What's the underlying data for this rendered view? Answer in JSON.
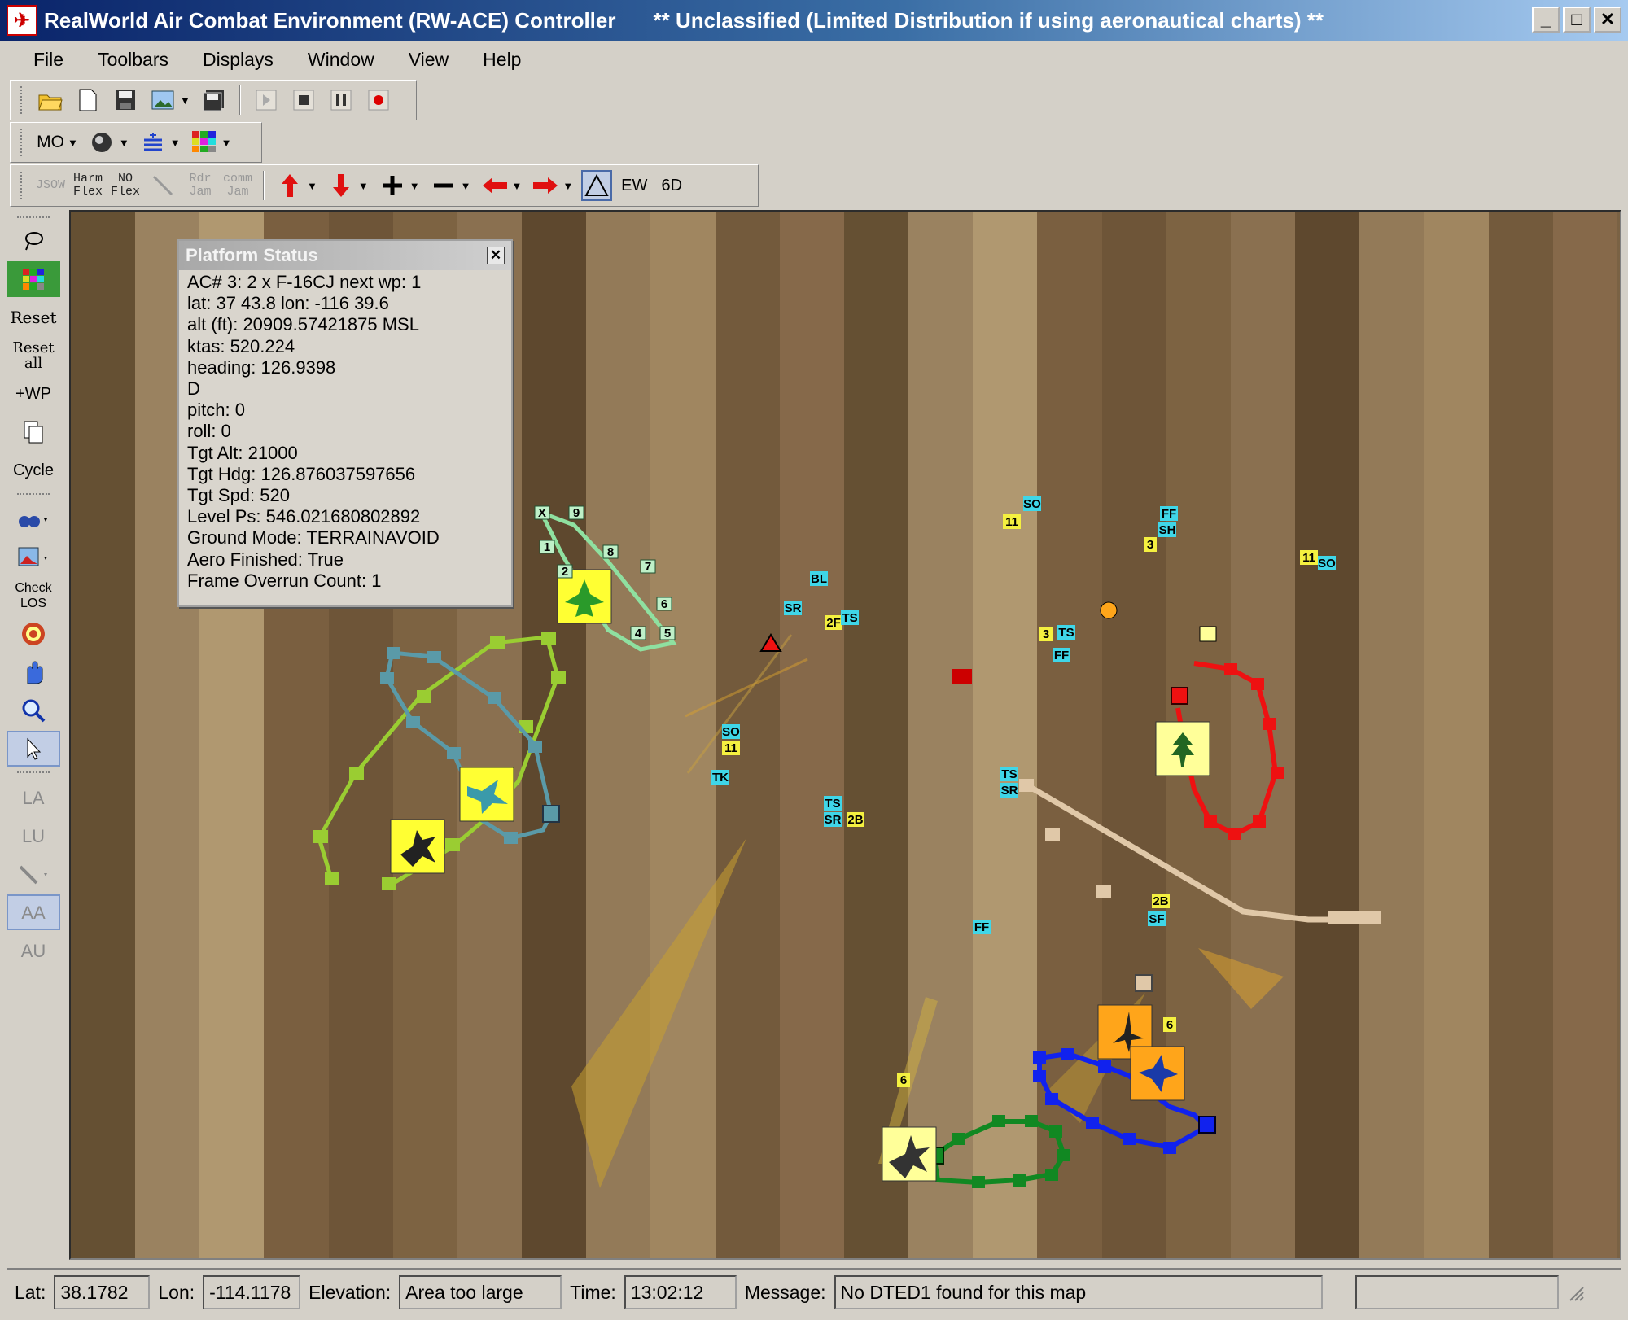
{
  "window": {
    "title": "RealWorld Air Combat Environment (RW-ACE) Controller",
    "classification": "** Unclassified (Limited Distribution if using aeronautical charts) **",
    "buttons": [
      "_",
      "□",
      "✕"
    ]
  },
  "menu": [
    "File",
    "Toolbars",
    "Displays",
    "Window",
    "View",
    "Help"
  ],
  "toolbar1": {
    "icons": [
      "open-folder-icon",
      "new-file-icon",
      "save-icon",
      "image-icon",
      "save-all-icon",
      "play-icon",
      "stop-icon",
      "pause-icon",
      "record-icon"
    ]
  },
  "toolbar2": {
    "mode_label": "MO"
  },
  "toolbar3": {
    "jsow": "JSOW",
    "harm_flex": "Harm\nFlex",
    "no_flex": "NO\nFlex",
    "rdr_jam": "Rdr\nJam",
    "comm_jam": "comm\nJam",
    "ew": "EW",
    "sixd": "6D"
  },
  "sidebar": {
    "reset": "Reset",
    "reset_all": "Reset\nall",
    "add_wp": "+WP",
    "cycle": "Cycle",
    "check_los": "Check\nLOS",
    "la": "LA",
    "lu": "LU",
    "aa": "AA",
    "au": "AU"
  },
  "platform_status": {
    "title": "Platform Status",
    "lines": [
      "AC# 3: 2 x F-16CJ next wp: 1",
      "lat: 37 43.8  lon: -116 39.6",
      "alt (ft): 20909.57421875 MSL",
      "ktas: 520.224",
      "heading: 126.9398",
      "D",
      "pitch: 0",
      "roll: 0",
      "Tgt Alt: 21000",
      "Tgt Hdg: 126.876037597656",
      "Tgt Spd: 520",
      "Level Ps: 546.021680802892",
      "Ground Mode: TERRAINAVOID",
      "Aero Finished: True",
      "Frame Overrun Count: 1"
    ]
  },
  "map_labels": [
    {
      "text": "SO",
      "color": "#3fd6e8"
    },
    {
      "text": "11",
      "color": "#f4f040"
    },
    {
      "text": "FF",
      "color": "#3fd6e8"
    },
    {
      "text": "SH",
      "color": "#3fd6e8"
    },
    {
      "text": "3",
      "color": "#f4f040"
    },
    {
      "text": "11",
      "color": "#f4f040"
    },
    {
      "text": "SO",
      "color": "#3fd6e8"
    },
    {
      "text": "BL",
      "color": "#3fd6e8"
    },
    {
      "text": "SR",
      "color": "#3fd6e8"
    },
    {
      "text": "2F",
      "color": "#f4f040"
    },
    {
      "text": "TS",
      "color": "#3fd6e8"
    },
    {
      "text": "3",
      "color": "#f4f040"
    },
    {
      "text": "TS",
      "color": "#3fd6e8"
    },
    {
      "text": "FF",
      "color": "#3fd6e8"
    },
    {
      "text": "SO",
      "color": "#3fd6e8"
    },
    {
      "text": "11",
      "color": "#f4f040"
    },
    {
      "text": "TK",
      "color": "#3fd6e8"
    },
    {
      "text": "TS",
      "color": "#3fd6e8"
    },
    {
      "text": "SR",
      "color": "#3fd6e8"
    },
    {
      "text": "TS",
      "color": "#3fd6e8"
    },
    {
      "text": "SR",
      "color": "#3fd6e8"
    },
    {
      "text": "2B",
      "color": "#f4f040"
    },
    {
      "text": "FF",
      "color": "#3fd6e8"
    },
    {
      "text": "2B",
      "color": "#f4f040"
    },
    {
      "text": "SF",
      "color": "#3fd6e8"
    },
    {
      "text": "6",
      "color": "#f4f040"
    },
    {
      "text": "6",
      "color": "#f4f040"
    }
  ],
  "waypoint_labels": [
    "X",
    "9",
    "8",
    "1",
    "2",
    "7",
    "6",
    "4",
    "5"
  ],
  "statusbar": {
    "lat_label": "Lat:",
    "lat_value": "38.1782",
    "lon_label": "Lon:",
    "lon_value": "-114.1178",
    "elev_label": "Elevation:",
    "elev_value": "Area too large",
    "time_label": "Time:",
    "time_value": "13:02:12",
    "msg_label": "Message:",
    "msg_value": "No DTED1 found for this map"
  },
  "colors": {
    "titlebar": "#0a246a",
    "route_lime": "#9acd32",
    "route_teal": "#5a9aa8",
    "route_mint": "#8fe0a0",
    "route_red": "#ee1111",
    "route_blue": "#1122ee",
    "route_green": "#118822",
    "route_tan": "#e0c8a8",
    "icon_yellow": "#ffff33",
    "icon_orange": "#ffa51a"
  }
}
